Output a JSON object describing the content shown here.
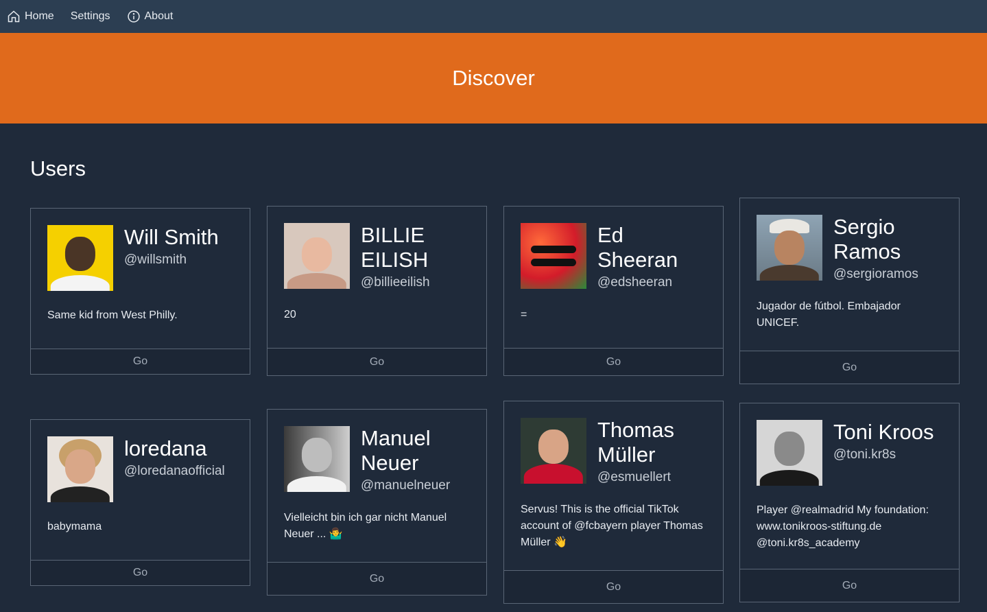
{
  "nav": {
    "home": "Home",
    "settings": "Settings",
    "about": "About"
  },
  "banner": {
    "title": "Discover"
  },
  "section": {
    "title": "Users"
  },
  "colors": {
    "accent": "#e06a1c",
    "nav_bg": "#2c3e52",
    "page_bg": "#1f2a3a"
  },
  "users": [
    {
      "name": "Will Smith",
      "handle": "@willsmith",
      "bio": "Same kid from West Philly.",
      "go": "Go"
    },
    {
      "name": "BILLIE EILISH",
      "handle": "@billieeilish",
      "bio": "20",
      "go": "Go"
    },
    {
      "name": "Ed Sheeran",
      "handle": "@edsheeran",
      "bio": "=",
      "go": "Go"
    },
    {
      "name": "Sergio Ramos",
      "handle": "@sergioramos",
      "bio": "Jugador de fútbol. Embajador UNICEF.",
      "go": "Go"
    },
    {
      "name": "loredana",
      "handle": "@loredanaofficial",
      "bio": "babymama",
      "go": "Go"
    },
    {
      "name": "Manuel Neuer",
      "handle": "@manuelneuer",
      "bio": "Vielleicht bin ich gar nicht Manuel Neuer ... 🤷‍♂",
      "go": "Go"
    },
    {
      "name": "Thomas Müller",
      "handle": "@esmuellert",
      "bio": "Servus! This is the official TikTok account of @fcbayern player Thomas Müller 👋",
      "go": "Go"
    },
    {
      "name": "Toni Kroos",
      "handle": "@toni.kr8s",
      "bio": "Player @realmadrid My foundation: www.tonikroos-stiftung.de @toni.kr8s_academy",
      "go": "Go"
    }
  ]
}
